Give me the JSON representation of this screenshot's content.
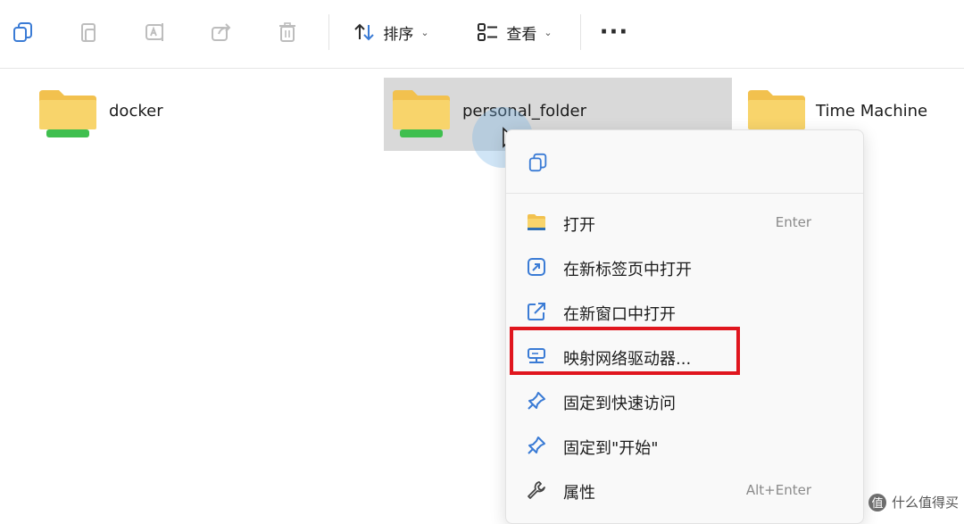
{
  "toolbar": {
    "sort_label": "排序",
    "view_label": "查看",
    "more_label": "···",
    "caret": "⌄"
  },
  "folders": [
    {
      "name": "docker"
    },
    {
      "name": "personal_folder"
    },
    {
      "name": "Time Machine"
    }
  ],
  "context_menu": {
    "items": [
      {
        "label": "打开",
        "shortcut": "Enter",
        "icon": "folder-icon"
      },
      {
        "label": "在新标签页中打开",
        "icon": "new-tab-icon"
      },
      {
        "label": "在新窗口中打开",
        "icon": "open-external-icon"
      },
      {
        "label": "映射网络驱动器...",
        "icon": "network-drive-icon",
        "highlighted": true
      },
      {
        "label": "固定到快速访问",
        "icon": "pin-icon"
      },
      {
        "label": "固定到\"开始\"",
        "icon": "pin-icon"
      },
      {
        "label": "属性",
        "shortcut": "Alt+Enter",
        "icon": "wrench-icon"
      }
    ]
  },
  "watermark": {
    "badge": "值",
    "text": "什么值得买"
  },
  "colors": {
    "folder_yellow": "#f8cf58",
    "folder_green_bar": "#3fbf4f",
    "highlight_red": "#e0161e",
    "selection_gray": "#d9d9d9",
    "icon_blue": "#3a7bd5"
  }
}
